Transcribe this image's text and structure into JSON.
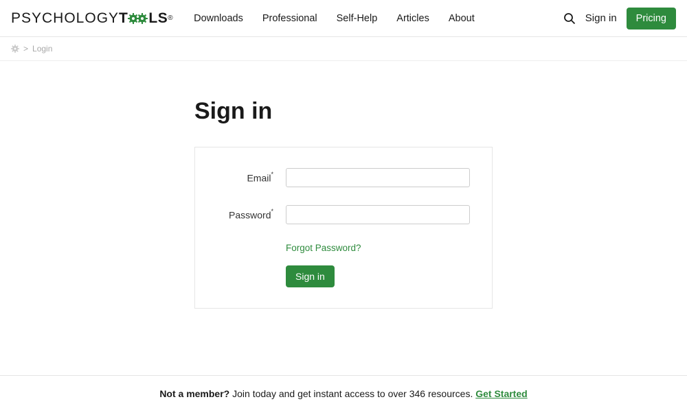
{
  "brand": {
    "part1": "PSYCHOLOGY",
    "part2": "T",
    "part3": "LS",
    "reg": "®",
    "gear_color": "#2e8b3d"
  },
  "nav": {
    "downloads": "Downloads",
    "professional": "Professional",
    "selfhelp": "Self-Help",
    "articles": "Articles",
    "about": "About"
  },
  "header": {
    "signin": "Sign in",
    "pricing": "Pricing"
  },
  "breadcrumb": {
    "sep": ">",
    "current": "Login"
  },
  "page": {
    "title": "Sign in"
  },
  "form": {
    "email_label": "Email",
    "password_label": "Password",
    "required_mark": "*",
    "forgot": "Forgot Password?",
    "submit": "Sign in"
  },
  "footer": {
    "lead": "Not a member?",
    "text": " Join today and get instant access to over 346 resources. ",
    "cta": "Get Started"
  }
}
